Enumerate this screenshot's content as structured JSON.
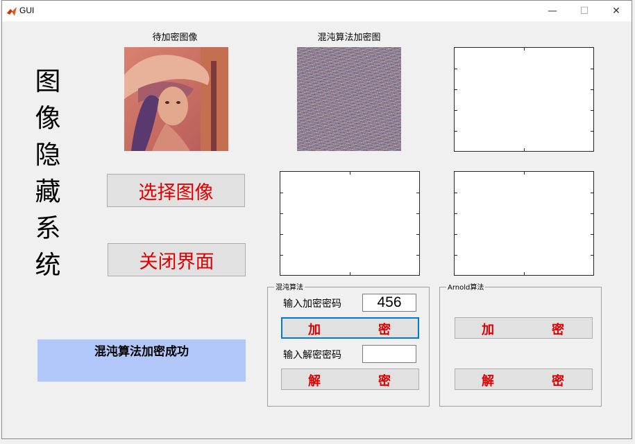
{
  "window": {
    "title": "GUI",
    "minimize_symbol": "—",
    "maximize_symbol": "☐",
    "close_symbol": "✕"
  },
  "main_title_chars": [
    "图",
    "像",
    "隐",
    "藏",
    "系",
    "统"
  ],
  "images": {
    "original_caption": "待加密图像",
    "encrypted_caption": "混沌算法加密图"
  },
  "buttons": {
    "select_image": "选择图像",
    "close_ui": "关闭界面"
  },
  "status_text": "混沌算法加密成功",
  "chaos_panel": {
    "title": "混沌算法",
    "encrypt_label": "输入加密密码",
    "encrypt_value": "456",
    "encrypt_button": [
      "加",
      "密"
    ],
    "decrypt_label": "输入解密密码",
    "decrypt_value": "",
    "decrypt_button": [
      "解",
      "密"
    ]
  },
  "arnold_panel": {
    "title": "Arnold算法",
    "encrypt_button": [
      "加",
      "密"
    ],
    "decrypt_button": [
      "解",
      "密"
    ]
  }
}
